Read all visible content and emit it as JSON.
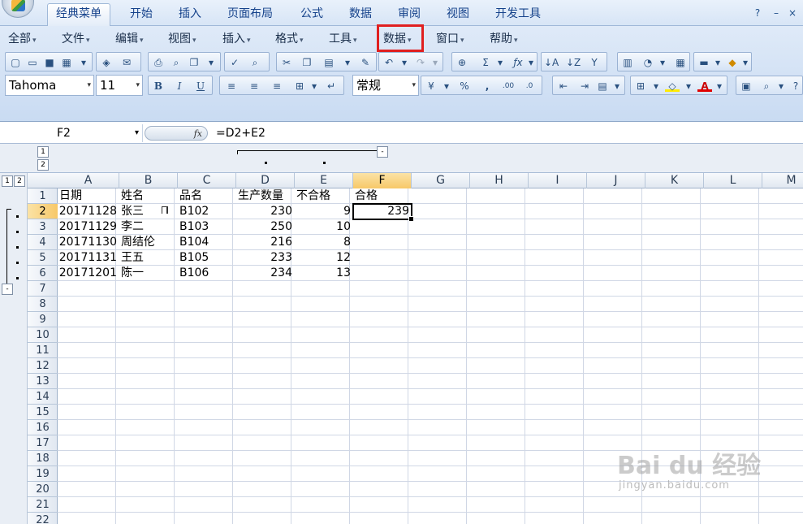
{
  "ribbon_tabs": [
    "经典菜单",
    "开始",
    "插入",
    "页面布局",
    "公式",
    "数据",
    "审阅",
    "视图",
    "开发工具"
  ],
  "active_tab": "经典菜单",
  "classic_menus": [
    "全部",
    "文件",
    "编辑",
    "视图",
    "插入",
    "格式",
    "工具",
    "数据",
    "窗口",
    "帮助"
  ],
  "highlighted_menu": "数据",
  "font": {
    "name": "Tahoma",
    "size": "11"
  },
  "number_format": "常规",
  "formula_bar": {
    "name_box": "F2",
    "fx_label": "fx",
    "formula": "=D2+E2"
  },
  "outline": {
    "levels": [
      "1",
      "2"
    ],
    "collapse": "-"
  },
  "columns": [
    "A",
    "B",
    "C",
    "D",
    "E",
    "F",
    "G",
    "H",
    "I",
    "J",
    "K",
    "L",
    "M"
  ],
  "selected_column": "F",
  "row_numbers": [
    "1",
    "2",
    "3",
    "4",
    "5",
    "6",
    "7",
    "8",
    "9",
    "10",
    "11",
    "12",
    "13",
    "14",
    "15",
    "16",
    "17",
    "18",
    "19",
    "20",
    "21",
    "22"
  ],
  "selected_row": "2",
  "table": {
    "headers": [
      "日期",
      "姓名",
      "品名",
      "生产数量",
      "不合格",
      "合格"
    ],
    "rows": [
      [
        "20171128",
        "张三",
        "B102",
        "230",
        "9",
        "239"
      ],
      [
        "20171129",
        "李二",
        "B103",
        "250",
        "10",
        ""
      ],
      [
        "20171130",
        "周结伦",
        "B104",
        "216",
        "8",
        ""
      ],
      [
        "20171131",
        "王五",
        "B105",
        "233",
        "12",
        ""
      ],
      [
        "20171201",
        "陈一",
        "B106",
        "234",
        "13",
        ""
      ]
    ]
  },
  "watermark": {
    "text": "Bai du 经验",
    "url": "jingyan.baidu.com"
  },
  "colors": {
    "accent": "#15428b",
    "highlight": "#e02020",
    "selected_header": "#f7c868"
  }
}
